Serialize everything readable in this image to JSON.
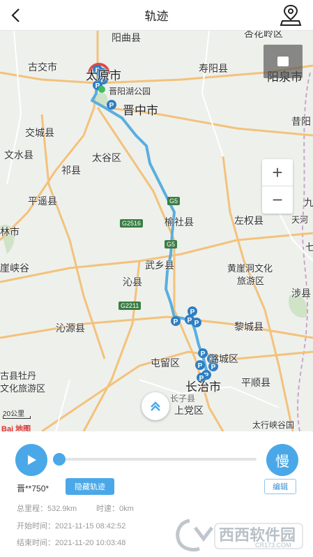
{
  "header": {
    "title": "轨迹"
  },
  "map": {
    "places": {
      "yangqu": "阳曲县",
      "xinghualing": "杏花岭区",
      "gujiao": "古交市",
      "taiyuan": "太原市",
      "shouyang": "寿阳县",
      "yangquan": "阳泉市",
      "jinyang_park": "晋阳湖公园",
      "jinzhong": "晋中市",
      "xiyang": "昔阳",
      "jiaocheng": "交城县",
      "wenshui": "文水县",
      "taigu": "太谷区",
      "qixian": "祁县",
      "pingyao": "平遥县",
      "jiexiu": "林市",
      "yushe": "榆社县",
      "zuoquan": "左权县",
      "tianzhi": "天河",
      "qi": "七",
      "jiu": "九",
      "mianshan": "崖峡谷",
      "wuxiang": "武乡县",
      "huangyadong": "黄崖洞文化",
      "lvyouqu": "旅游区",
      "qinxian": "沁县",
      "shexian": "涉县",
      "qinyuan": "沁源县",
      "licheng": "黎城县",
      "tunliu": "屯留区",
      "lucheng": "潞城区",
      "changzhi": "长治市",
      "pingshun": "平顺县",
      "gu_mudan": "古县牡丹",
      "wenhua_lvyou": "文化旅游区",
      "shangdang": "上党区",
      "zhangzi": "长子县",
      "taihang": "太行峡谷国"
    },
    "shields": {
      "g5a": "G5",
      "g2516": "G2516",
      "g5b": "G5",
      "g2211": "G2211"
    },
    "scale": "20公里",
    "logo": "Bai 地图"
  },
  "panel": {
    "speed_label": "慢",
    "plate": "晋**750*",
    "hide_track_label": "隐藏轨迹",
    "edit_label": "编辑",
    "total_distance": "总里程：532.9km",
    "speed": "时速：0km",
    "start_time": "开始时间：2021-11-15 08:42:52",
    "end_time": "结束时间：2021-11-20 10:03:48"
  },
  "watermark": {
    "brand": "西西软件园",
    "site": "CR173.COM"
  },
  "colors": {
    "accent": "#4aa8e8",
    "route": "#5aaee0",
    "road": "#f3c27a"
  }
}
